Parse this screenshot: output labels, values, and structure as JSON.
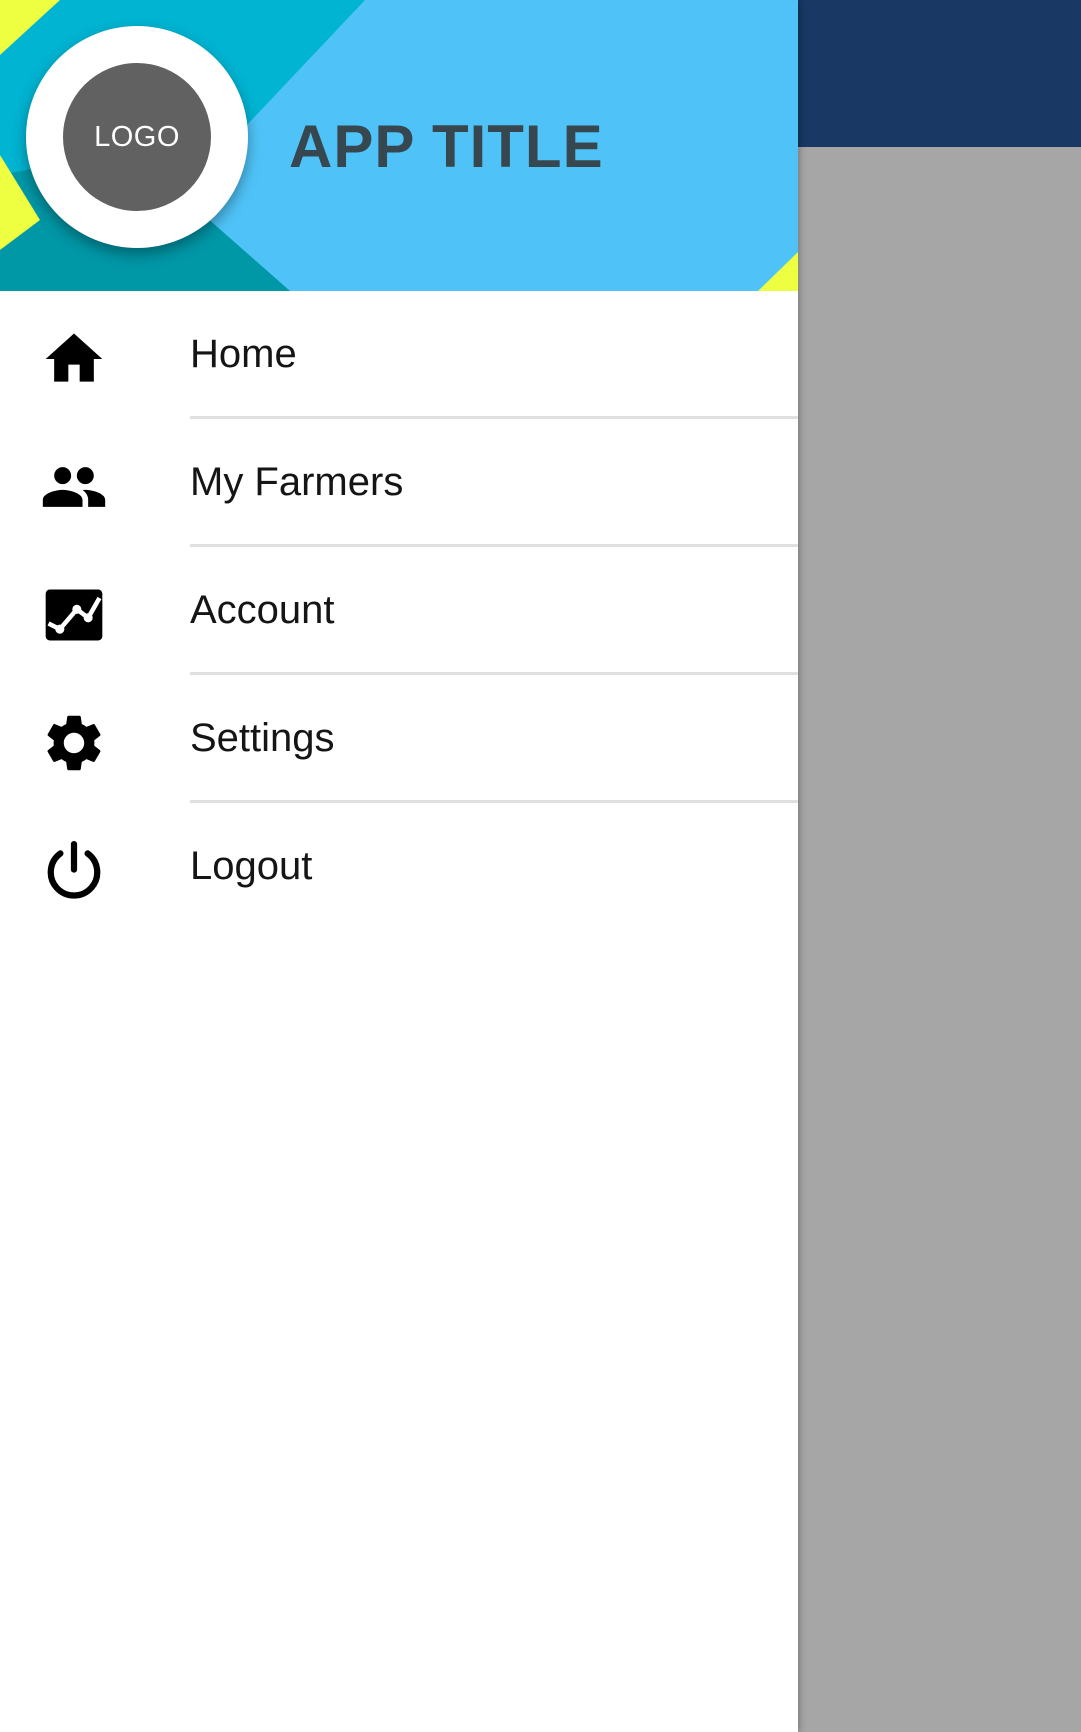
{
  "header": {
    "logo_text": "LOGO",
    "app_title": "APP TITLE"
  },
  "menu": {
    "items": [
      {
        "label": "Home",
        "icon": "home-icon"
      },
      {
        "label": "My Farmers",
        "icon": "people-icon"
      },
      {
        "label": "Account",
        "icon": "chart-icon"
      },
      {
        "label": "Settings",
        "icon": "gear-icon"
      },
      {
        "label": "Logout",
        "icon": "power-icon"
      }
    ]
  },
  "colors": {
    "header_background": "#4fc3f7",
    "header_accent_teal": "#00b4d2",
    "header_accent_dark_teal": "#0097a7",
    "header_accent_yellow": "#eeff41",
    "app_bar": "#193864",
    "scrim": "#a6a6a6",
    "logo_disc": "#616161",
    "title_text": "#37474f"
  }
}
